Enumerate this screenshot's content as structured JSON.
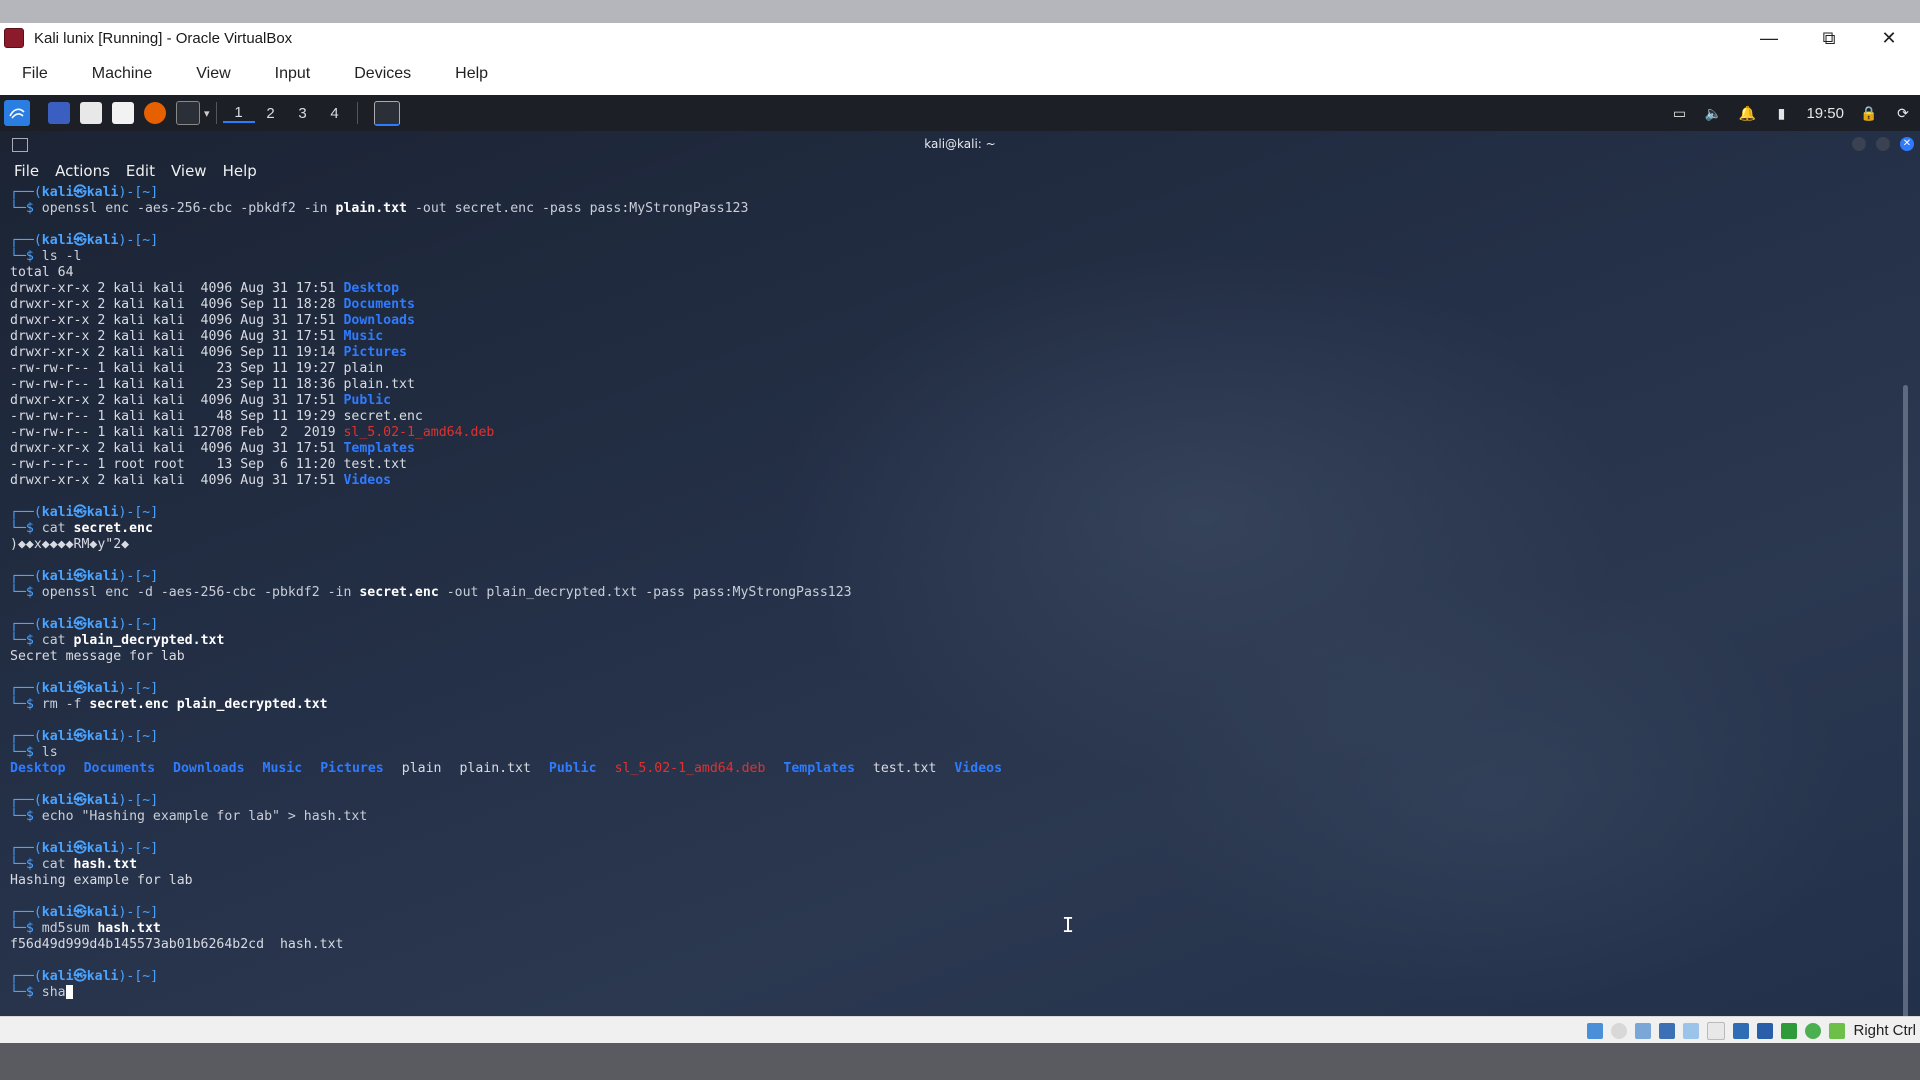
{
  "vbox": {
    "title": "Kali lunix [Running] - Oracle VirtualBox",
    "menu": [
      "File",
      "Machine",
      "View",
      "Input",
      "Devices",
      "Help"
    ],
    "status_hostkey": "Right Ctrl"
  },
  "panel": {
    "workspaces": [
      "1",
      "2",
      "3",
      "4"
    ],
    "clock": "19:50"
  },
  "terminal": {
    "title": "kali@kali: ~",
    "menu": [
      "File",
      "Actions",
      "Edit",
      "View",
      "Help"
    ],
    "prompt": {
      "top": "┌──(",
      "user": "kali㉿kali",
      "path": ")-[~]",
      "bottom": "└─$ "
    },
    "blocks": [
      {
        "cmd": "openssl enc -aes-256-cbc -pbkdf2 -in ",
        "cmd_bold": "plain.txt",
        "cmd_rest": " -out secret.enc -pass pass:MyStrongPass123",
        "output": []
      },
      {
        "cmd": "ls -l",
        "cmd_bold": "",
        "cmd_rest": "",
        "output": [
          {
            "text": "total 64",
            "name": ""
          },
          {
            "text": "drwxr-xr-x 2 kali kali  4096 Aug 31 17:51 ",
            "name": "Desktop",
            "cls": "dir"
          },
          {
            "text": "drwxr-xr-x 2 kali kali  4096 Sep 11 18:28 ",
            "name": "Documents",
            "cls": "dir"
          },
          {
            "text": "drwxr-xr-x 2 kali kali  4096 Aug 31 17:51 ",
            "name": "Downloads",
            "cls": "dir"
          },
          {
            "text": "drwxr-xr-x 2 kali kali  4096 Aug 31 17:51 ",
            "name": "Music",
            "cls": "dir"
          },
          {
            "text": "drwxr-xr-x 2 kali kali  4096 Sep 11 19:14 ",
            "name": "Pictures",
            "cls": "dir"
          },
          {
            "text": "-rw-rw-r-- 1 kali kali    23 Sep 11 19:27 ",
            "name": "plain",
            "cls": ""
          },
          {
            "text": "-rw-rw-r-- 1 kali kali    23 Sep 11 18:36 ",
            "name": "plain.txt",
            "cls": ""
          },
          {
            "text": "drwxr-xr-x 2 kali kali  4096 Aug 31 17:51 ",
            "name": "Public",
            "cls": "dir"
          },
          {
            "text": "-rw-rw-r-- 1 kali kali    48 Sep 11 19:29 ",
            "name": "secret.enc",
            "cls": ""
          },
          {
            "text": "-rw-rw-r-- 1 kali kali 12708 Feb  2  2019 ",
            "name": "sl_5.02-1_amd64.deb",
            "cls": "red"
          },
          {
            "text": "drwxr-xr-x 2 kali kali  4096 Aug 31 17:51 ",
            "name": "Templates",
            "cls": "dir"
          },
          {
            "text": "-rw-r--r-- 1 root root    13 Sep  6 11:20 ",
            "name": "test.txt",
            "cls": ""
          },
          {
            "text": "drwxr-xr-x 2 kali kali  4096 Aug 31 17:51 ",
            "name": "Videos",
            "cls": "dir"
          }
        ]
      },
      {
        "cmd": "cat ",
        "cmd_bold": "secret.enc",
        "cmd_rest": "",
        "output": [
          {
            "text": ")◆◆x◆◆◆◆RM◆y\"2◆",
            "name": ""
          }
        ]
      },
      {
        "cmd": "openssl enc -d -aes-256-cbc -pbkdf2 -in ",
        "cmd_bold": "secret.enc",
        "cmd_rest": " -out plain_decrypted.txt -pass pass:MyStrongPass123",
        "output": []
      },
      {
        "cmd": "cat ",
        "cmd_bold": "plain_decrypted.txt",
        "cmd_rest": "",
        "output": [
          {
            "text": "Secret message for lab",
            "name": ""
          }
        ]
      },
      {
        "cmd": "rm -f ",
        "cmd_bold": "secret.enc plain_decrypted.txt",
        "cmd_rest": "",
        "output": []
      },
      {
        "cmd": "ls",
        "cmd_bold": "",
        "cmd_rest": "",
        "output": [],
        "ls": [
          {
            "name": "Desktop",
            "cls": "dir"
          },
          {
            "name": "Documents",
            "cls": "dir"
          },
          {
            "name": "Downloads",
            "cls": "dir"
          },
          {
            "name": "Music",
            "cls": "dir"
          },
          {
            "name": "Pictures",
            "cls": "dir"
          },
          {
            "name": "plain",
            "cls": ""
          },
          {
            "name": "plain.txt",
            "cls": ""
          },
          {
            "name": "Public",
            "cls": "dir"
          },
          {
            "name": "sl_5.02-1_amd64.deb",
            "cls": "red"
          },
          {
            "name": "Templates",
            "cls": "dir"
          },
          {
            "name": "test.txt",
            "cls": ""
          },
          {
            "name": "Videos",
            "cls": "dir"
          }
        ]
      },
      {
        "cmd": "echo \"Hashing example for lab\" > hash.txt",
        "cmd_bold": "",
        "cmd_rest": "",
        "output": []
      },
      {
        "cmd": "cat ",
        "cmd_bold": "hash.txt",
        "cmd_rest": "",
        "output": [
          {
            "text": "Hashing example for lab",
            "name": ""
          }
        ]
      },
      {
        "cmd": "md5sum ",
        "cmd_bold": "hash.txt",
        "cmd_rest": "",
        "output": [
          {
            "text": "f56d49d999d4b145573ab01b6264b2cd  hash.txt",
            "name": ""
          }
        ]
      },
      {
        "cmd": "sha",
        "cmd_bold": "",
        "cmd_rest": "",
        "output": [],
        "current": true
      }
    ]
  }
}
